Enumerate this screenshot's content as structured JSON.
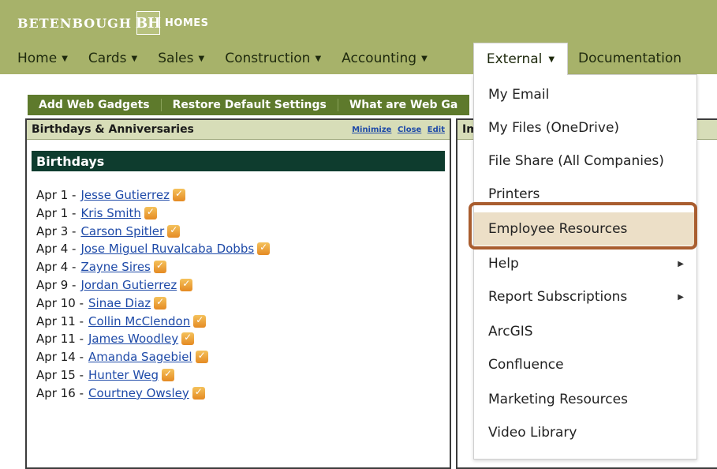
{
  "header": {
    "logo_text_left": "BETENBOUGH",
    "logo_mark": "BH",
    "logo_text_right": "HOMES"
  },
  "nav": {
    "items": [
      {
        "label": "Home"
      },
      {
        "label": "Cards"
      },
      {
        "label": "Sales"
      },
      {
        "label": "Construction"
      },
      {
        "label": "Accounting"
      }
    ],
    "active": "External",
    "documentation": "Documentation"
  },
  "toolbar": {
    "add_gadgets": "Add Web Gadgets",
    "restore_defaults": "Restore Default Settings",
    "what_are": "What are Web Ga"
  },
  "left_panel": {
    "title": "Birthdays & Anniversaries",
    "links": [
      "Minimize",
      "Close",
      "Edit"
    ],
    "section": "Birthdays",
    "rows": [
      {
        "date": "Apr 1 -",
        "name": "Jesse Gutierrez"
      },
      {
        "date": "Apr 1 -",
        "name": "Kris Smith"
      },
      {
        "date": "Apr 3 -",
        "name": "Carson Spitler"
      },
      {
        "date": "Apr 4 -",
        "name": "Jose Miguel Ruvalcaba Dobbs"
      },
      {
        "date": "Apr 4 -",
        "name": "Zayne Sires"
      },
      {
        "date": "Apr 9 -",
        "name": "Jordan Gutierrez"
      },
      {
        "date": "Apr 10 -",
        "name": "Sinae Diaz"
      },
      {
        "date": "Apr 11 -",
        "name": "Collin McClendon"
      },
      {
        "date": "Apr 11 -",
        "name": "James Woodley"
      },
      {
        "date": "Apr 14 -",
        "name": "Amanda Sagebiel"
      },
      {
        "date": "Apr 15 -",
        "name": "Hunter Weg"
      },
      {
        "date": "Apr 16 -",
        "name": "Courtney Owsley"
      }
    ]
  },
  "right_panel": {
    "title": "Im"
  },
  "dropdown": {
    "items": [
      {
        "label": "My Email",
        "submenu": false
      },
      {
        "label": "My Files (OneDrive)",
        "submenu": false
      },
      {
        "label": "File Share (All Companies)",
        "submenu": false
      },
      {
        "label": "Printers",
        "submenu": false
      },
      {
        "label": "Employee Resources",
        "submenu": false,
        "highlighted": true
      },
      {
        "label": "Help",
        "submenu": true
      },
      {
        "label": "Report Subscriptions",
        "submenu": true
      },
      {
        "label": "ArcGIS",
        "submenu": false
      },
      {
        "label": "Confluence",
        "submenu": false
      },
      {
        "label": "Marketing Resources",
        "submenu": false
      },
      {
        "label": "Video Library",
        "submenu": false
      }
    ]
  },
  "colors": {
    "header_bg": "#a7b26a",
    "toolbar_bg": "#5e7a2c",
    "section_bg": "#0e3c2e",
    "link": "#1e4aa8",
    "highlight_border": "#a95d2f",
    "highlight_fill": "#ecdfc7"
  }
}
